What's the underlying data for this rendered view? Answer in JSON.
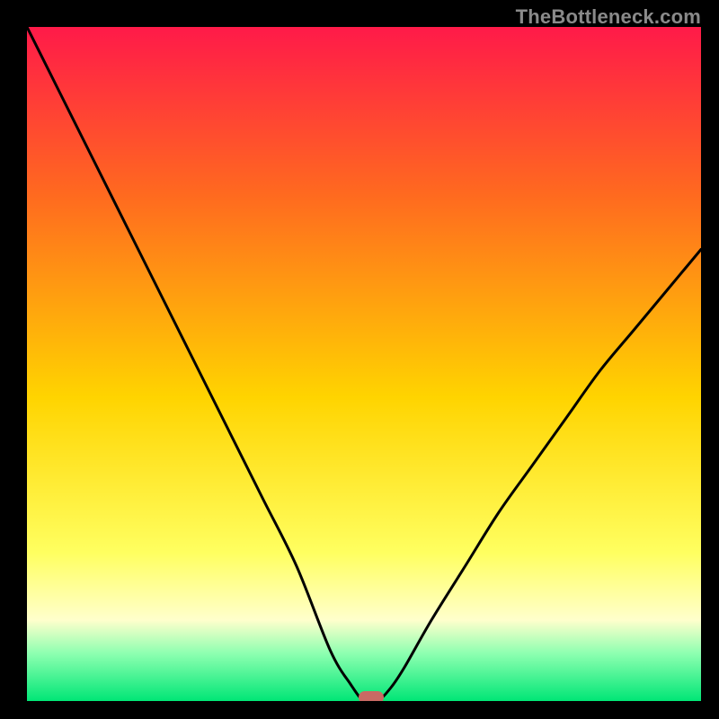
{
  "watermark": "TheBottleneck.com",
  "colors": {
    "bg_black": "#000000",
    "grad_top": "#ff1a49",
    "grad_mid_upper": "#ff6a1f",
    "grad_mid": "#ffd400",
    "grad_low": "#ffff60",
    "grad_pale": "#ffffcc",
    "grad_green_light": "#8cffb0",
    "grad_green": "#00e676",
    "curve": "#000000",
    "marker": "#c96a64"
  },
  "chart_data": {
    "type": "line",
    "title": "",
    "xlabel": "",
    "ylabel": "",
    "xlim": [
      0,
      100
    ],
    "ylim": [
      0,
      100
    ],
    "series": [
      {
        "name": "bottleneck-curve",
        "x": [
          0,
          5,
          10,
          15,
          20,
          25,
          30,
          35,
          40,
          45,
          48,
          50,
          52,
          54,
          56,
          60,
          65,
          70,
          75,
          80,
          85,
          90,
          95,
          100
        ],
        "values": [
          100,
          90,
          80,
          70,
          60,
          50,
          40,
          30,
          20,
          7.5,
          2.5,
          0,
          0,
          2,
          5,
          12,
          20,
          28,
          35,
          42,
          49,
          55,
          61,
          67
        ]
      }
    ],
    "annotations": [
      {
        "name": "min-marker",
        "x": 51,
        "y": 0,
        "shape": "pill",
        "color": "#c96a64"
      }
    ],
    "background_gradient_stops": [
      {
        "pos": 0.0,
        "color": "#ff1a49"
      },
      {
        "pos": 0.25,
        "color": "#ff6a1f"
      },
      {
        "pos": 0.55,
        "color": "#ffd400"
      },
      {
        "pos": 0.78,
        "color": "#ffff60"
      },
      {
        "pos": 0.88,
        "color": "#ffffcc"
      },
      {
        "pos": 0.93,
        "color": "#8cffb0"
      },
      {
        "pos": 1.0,
        "color": "#00e676"
      }
    ]
  }
}
